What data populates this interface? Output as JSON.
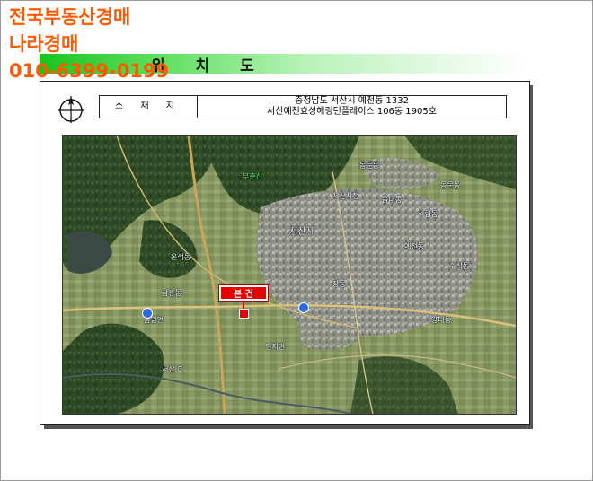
{
  "ad": {
    "line1": "전국부동산경매",
    "line2": "나라경매",
    "line3": "010-6399-0199",
    "color": "#ff5a00"
  },
  "banner": {
    "title": "위 치 도",
    "color": "#19c31e"
  },
  "info_table": {
    "label": "소 재 지",
    "address_line1": "충청남도 서산시 예천동 1332",
    "address_line2": "서산예천효성해링턴플레이스 106동 1905호"
  },
  "map": {
    "marker_label": "본 건",
    "marker_color": "#e60000",
    "labels": [
      {
        "text": "부춘산",
        "style": "green"
      },
      {
        "text": "동문동",
        "style": "white"
      },
      {
        "text": "서산시청",
        "style": "white"
      },
      {
        "text": "서산시",
        "style": "white"
      },
      {
        "text": "예천동",
        "style": "white"
      },
      {
        "text": "석림동",
        "style": "white"
      },
      {
        "text": "읍내동",
        "style": "white"
      },
      {
        "text": "수석동",
        "style": "white"
      },
      {
        "text": "양대동",
        "style": "white"
      },
      {
        "text": "장동",
        "style": "white"
      },
      {
        "text": "온석동",
        "style": "white"
      },
      {
        "text": "잠홍동",
        "style": "white"
      },
      {
        "text": "동문동",
        "style": "white"
      },
      {
        "text": "인지면",
        "style": "white"
      },
      {
        "text": "서산IC",
        "style": "white"
      },
      {
        "text": "음암면",
        "style": "white"
      }
    ]
  }
}
